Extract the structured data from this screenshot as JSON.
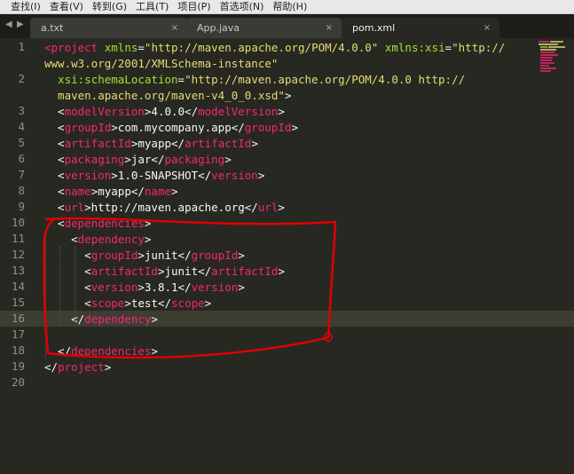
{
  "menu": [
    "查找(I)",
    "查看(V)",
    "转到(G)",
    "工具(T)",
    "项目(P)",
    "首选项(N)",
    "帮助(H)"
  ],
  "nav": {
    "left": "◀",
    "right": "▶"
  },
  "tabs": [
    {
      "label": "a.txt",
      "close": "×"
    },
    {
      "label": "App.java",
      "close": "×"
    },
    {
      "label": "pom.xml",
      "close": "×"
    }
  ],
  "line_numbers": [
    "1",
    "",
    "2",
    "",
    "3",
    "4",
    "5",
    "6",
    "7",
    "8",
    "9",
    "10",
    "11",
    "12",
    "13",
    "14",
    "15",
    "16",
    "17",
    "18",
    "19",
    "20"
  ],
  "code": [
    [
      [
        "t",
        "<project"
      ],
      [
        "p",
        " "
      ],
      [
        "a",
        "xmlns"
      ],
      [
        "p",
        "="
      ],
      [
        "s",
        "\"http://maven.apache.org/POM/4.0.0\""
      ],
      [
        "p",
        " "
      ],
      [
        "a",
        "xmlns:xsi"
      ],
      [
        "p",
        "="
      ],
      [
        "s",
        "\"http://"
      ]
    ],
    [
      [
        "s",
        "www.w3.org/2001/XMLSchema-instance\""
      ]
    ],
    [
      [
        "p",
        "  "
      ],
      [
        "a",
        "xsi:schemaLocation"
      ],
      [
        "p",
        "="
      ],
      [
        "s",
        "\"http://maven.apache.org/POM/4.0.0 http://"
      ]
    ],
    [
      [
        "s",
        "  maven.apache.org/maven-v4_0_0.xsd\""
      ],
      [
        "p",
        ">"
      ]
    ],
    [
      [
        "p",
        "  <"
      ],
      [
        "t",
        "modelVersion"
      ],
      [
        "p",
        ">4.0.0</"
      ],
      [
        "t",
        "modelVersion"
      ],
      [
        "p",
        ">"
      ]
    ],
    [
      [
        "p",
        "  <"
      ],
      [
        "t",
        "groupId"
      ],
      [
        "p",
        ">com.mycompany.app</"
      ],
      [
        "t",
        "groupId"
      ],
      [
        "p",
        ">"
      ]
    ],
    [
      [
        "p",
        "  <"
      ],
      [
        "t",
        "artifactId"
      ],
      [
        "p",
        ">myapp</"
      ],
      [
        "t",
        "artifactId"
      ],
      [
        "p",
        ">"
      ]
    ],
    [
      [
        "p",
        "  <"
      ],
      [
        "t",
        "packaging"
      ],
      [
        "p",
        ">jar</"
      ],
      [
        "t",
        "packaging"
      ],
      [
        "p",
        ">"
      ]
    ],
    [
      [
        "p",
        "  <"
      ],
      [
        "t",
        "version"
      ],
      [
        "p",
        ">1.0-SNAPSHOT</"
      ],
      [
        "t",
        "version"
      ],
      [
        "p",
        ">"
      ]
    ],
    [
      [
        "p",
        "  <"
      ],
      [
        "t",
        "name"
      ],
      [
        "p",
        ">myapp</"
      ],
      [
        "t",
        "name"
      ],
      [
        "p",
        ">"
      ]
    ],
    [
      [
        "p",
        "  <"
      ],
      [
        "t",
        "url"
      ],
      [
        "p",
        ">http://maven.apache.org</"
      ],
      [
        "t",
        "url"
      ],
      [
        "p",
        ">"
      ]
    ],
    [
      [
        "p",
        "  <"
      ],
      [
        "t",
        "dependencies"
      ],
      [
        "p",
        ">"
      ]
    ],
    [
      [
        "p",
        "    <"
      ],
      [
        "t",
        "dependency"
      ],
      [
        "p",
        ">"
      ]
    ],
    [
      [
        "p",
        "      <"
      ],
      [
        "t",
        "groupId"
      ],
      [
        "p",
        ">junit</"
      ],
      [
        "t",
        "groupId"
      ],
      [
        "p",
        ">"
      ]
    ],
    [
      [
        "p",
        "      <"
      ],
      [
        "t",
        "artifactId"
      ],
      [
        "p",
        ">junit</"
      ],
      [
        "t",
        "artifactId"
      ],
      [
        "p",
        ">"
      ]
    ],
    [
      [
        "p",
        "      <"
      ],
      [
        "t",
        "version"
      ],
      [
        "p",
        ">3.8.1</"
      ],
      [
        "t",
        "version"
      ],
      [
        "p",
        ">"
      ]
    ],
    [
      [
        "p",
        "      <"
      ],
      [
        "t",
        "scope"
      ],
      [
        "p",
        ">test</"
      ],
      [
        "t",
        "scope"
      ],
      [
        "p",
        ">"
      ]
    ],
    [
      [
        "p",
        "    </"
      ],
      [
        "t",
        "dependency"
      ],
      [
        "p",
        ">"
      ]
    ],
    [],
    [
      [
        "p",
        "  </"
      ],
      [
        "t",
        "dependencies"
      ],
      [
        "p",
        ">"
      ]
    ],
    [
      [
        "p",
        "</"
      ],
      [
        "t",
        "project"
      ],
      [
        "p",
        ">"
      ]
    ],
    []
  ],
  "colors": {
    "background": "#272822",
    "tag": "#f92672",
    "attribute": "#a6e22e",
    "string": "#e6db74",
    "text": "#f8f8f2",
    "gutter": "#8f908a",
    "annotation": "#e00000"
  },
  "annotation": "red-freehand-box-around-dependencies"
}
